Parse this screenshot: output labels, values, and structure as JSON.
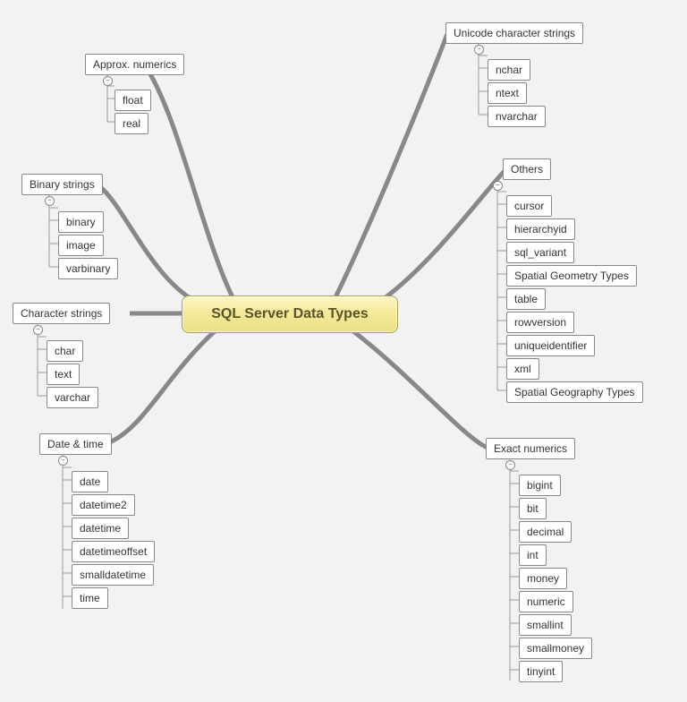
{
  "center": {
    "title": "SQL Server Data Types"
  },
  "branches": {
    "approx_numerics": {
      "title": "Approx. numerics",
      "children": [
        "float",
        "real"
      ]
    },
    "binary_strings": {
      "title": "Binary strings",
      "children": [
        "binary",
        "image",
        "varbinary"
      ]
    },
    "character_strings": {
      "title": "Character strings",
      "children": [
        "char",
        "text",
        "varchar"
      ]
    },
    "date_time": {
      "title": "Date & time",
      "children": [
        "date",
        "datetime2",
        "datetime",
        "datetimeoffset",
        "smalldatetime",
        "time"
      ]
    },
    "unicode_strings": {
      "title": "Unicode character strings",
      "children": [
        "nchar",
        "ntext",
        "nvarchar"
      ]
    },
    "others": {
      "title": "Others",
      "children": [
        "cursor",
        "hierarchyid",
        "sql_variant",
        "Spatial Geometry Types",
        "table",
        "rowversion",
        "uniqueidentifier",
        "xml",
        "Spatial Geography Types"
      ]
    },
    "exact_numerics": {
      "title": "Exact numerics",
      "children": [
        "bigint",
        "bit",
        "decimal",
        "int",
        "money",
        "numeric",
        "smallint",
        "smallmoney",
        "tinyint"
      ]
    }
  },
  "toggle_glyph": "−"
}
